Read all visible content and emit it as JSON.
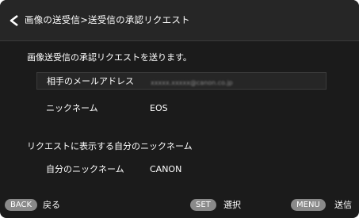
{
  "header": {
    "title": "画像の送受信>送受信の承認リクエスト"
  },
  "main": {
    "description": "画像送受信の承認リクエストを送ります。",
    "fields": [
      {
        "label": "相手のメールアドレス",
        "value": "xxxxx.xxxxx@canon.co.jp"
      },
      {
        "label": "ニックネーム",
        "value": "EOS"
      }
    ],
    "own_section_title": "リクエストに表示する自分のニックネーム",
    "own_nickname": {
      "label": "自分のニックネーム",
      "value": "CANON"
    }
  },
  "footer": {
    "back": {
      "key": "BACK",
      "label": "戻る"
    },
    "set": {
      "key": "SET",
      "label": "選択"
    },
    "menu": {
      "key": "MENU",
      "label": "送信"
    }
  },
  "colors": {
    "background": "#1b1b1b",
    "header": "#262626",
    "text": "#ffffff",
    "badge": "#8a8a8a",
    "selection": "#262626"
  }
}
